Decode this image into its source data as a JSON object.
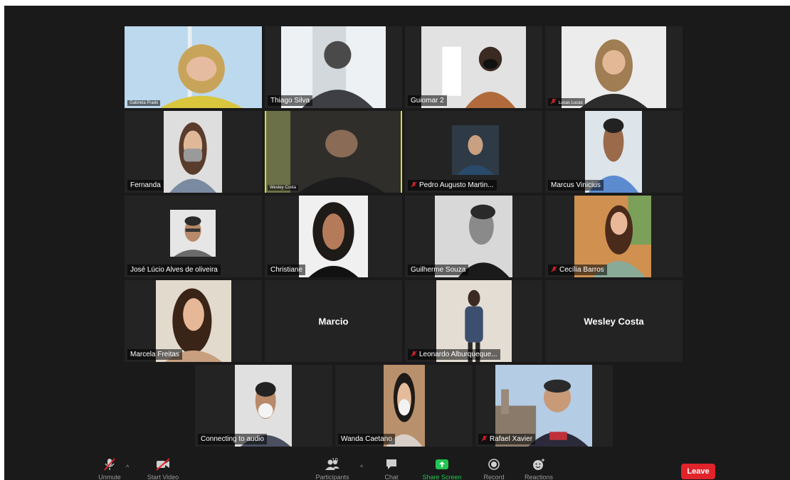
{
  "participants": [
    {
      "name": "Gabriela Prado",
      "muted": false
    },
    {
      "name": "Thiago Silva",
      "muted": false
    },
    {
      "name": "Guiomar 2",
      "muted": false
    },
    {
      "name": "Lucas Lucas",
      "muted": true
    },
    {
      "name": "Fernanda",
      "muted": false
    },
    {
      "name": "Wesley Costa",
      "muted": false
    },
    {
      "name": "Pedro Augusto Martin...",
      "muted": true
    },
    {
      "name": "Marcus Vinicius",
      "muted": false
    },
    {
      "name": "José Lúcio Alves de oliveira",
      "muted": false
    },
    {
      "name": "Christiane",
      "muted": false
    },
    {
      "name": "Guilherme Souza",
      "muted": false
    },
    {
      "name": "Cecília Barros",
      "muted": true
    },
    {
      "name": "Marcela Freitas",
      "muted": false
    },
    {
      "name": "Marcio",
      "muted": false
    },
    {
      "name": "Leonardo Alburqueque...",
      "muted": true
    },
    {
      "name": "Wesley Costa",
      "muted": false
    },
    {
      "name": "Connecting to audio",
      "muted": false
    },
    {
      "name": "Wanda Caetano",
      "muted": false
    },
    {
      "name": "Rafael Xavier",
      "muted": true
    }
  ],
  "toolbar": {
    "unmute": "Unmute",
    "start_video": "Start Video",
    "participants": "Participants",
    "participant_count": "19",
    "chat": "Chat",
    "share_screen": "Share Screen",
    "record": "Record",
    "reactions": "Reactions",
    "leave": "Leave"
  },
  "colors": {
    "active_speaker_border": "#d6dc4a",
    "share_screen": "#23c552",
    "leave": "#e0242a",
    "muted_icon": "#e0242a"
  }
}
